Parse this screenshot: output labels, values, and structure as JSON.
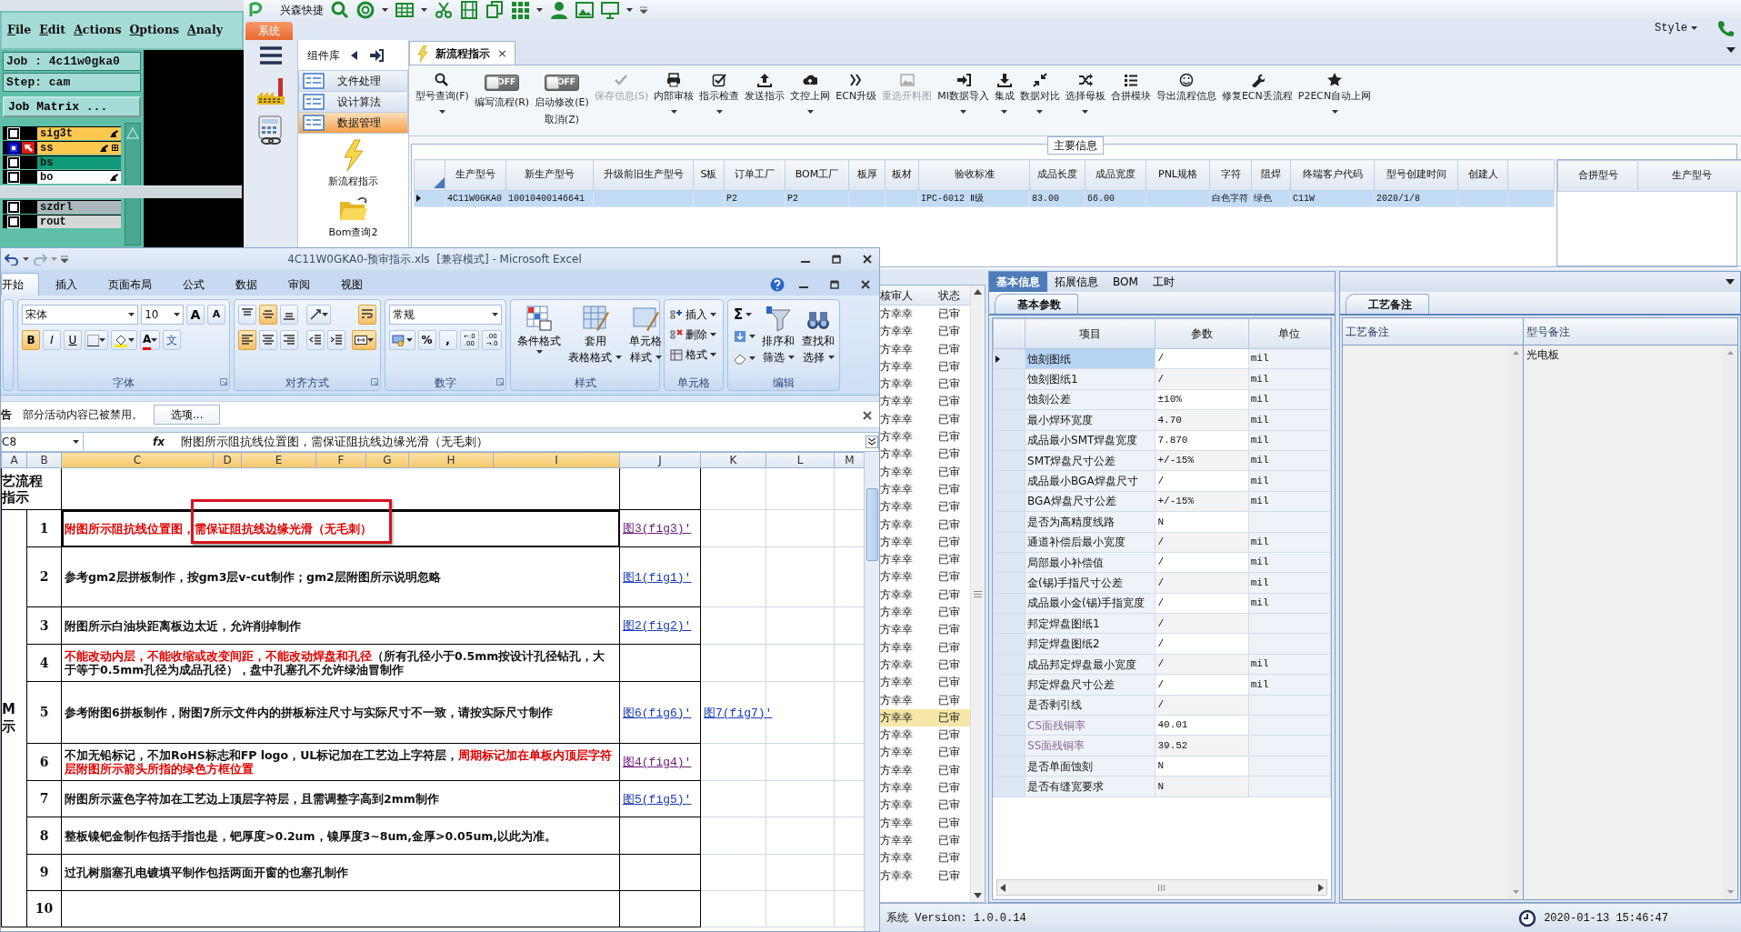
{
  "genesis": {
    "menu": [
      "File",
      "Edit",
      "Actions",
      "Options",
      "Analy"
    ],
    "job": "Job : 4c11w0gka0",
    "step": "Step: cam",
    "matrix_button": "Job Matrix ...",
    "layers": [
      {
        "name": "sig3t",
        "color": "#ffc850",
        "selected": false,
        "affected": true
      },
      {
        "name": "ss",
        "color": "#ffc850",
        "selected": true,
        "affected": true
      },
      {
        "name": "bs",
        "color": "#0f9a78",
        "selected": false,
        "affected": false
      },
      {
        "name": "bo",
        "color": "#ffffff",
        "selected": false,
        "affected": true
      }
    ],
    "lower_layers": [
      {
        "name": "szdrl",
        "color": "#aab8bc",
        "selected": false,
        "affected": false
      },
      {
        "name": "rout",
        "color": "#d4d8d8",
        "selected": false,
        "affected": false
      }
    ]
  },
  "app": {
    "quick_access": "兴森快捷",
    "style": "Style",
    "system_tab": "系统",
    "nav": {
      "title": "组件库",
      "groups": [
        {
          "label": "文件处理",
          "selected": false
        },
        {
          "label": "设计算法",
          "selected": false
        },
        {
          "label": "数据管理",
          "selected": true
        }
      ],
      "items": [
        {
          "label": "新流程指示",
          "kind": "flow"
        },
        {
          "label": "Bom查询2",
          "kind": "folder"
        }
      ]
    },
    "doc_tab": {
      "label": "新流程指示",
      "close": "×"
    },
    "toolbar": [
      {
        "kind": "button",
        "label": "型号查询(F)",
        "dropdown": true,
        "disabled": false
      },
      {
        "kind": "toggle",
        "label": "编写流程(R)",
        "value": "OFF",
        "on": false
      },
      {
        "kind": "toggle",
        "label": "启动修改(E)",
        "label2": "取消(Z)",
        "value": "OFF",
        "on": false
      },
      {
        "kind": "button",
        "label": "保存信息(S)",
        "dropdown": false,
        "disabled": true
      },
      {
        "kind": "button",
        "label": "内部审核",
        "dropdown": true,
        "disabled": false
      },
      {
        "kind": "button",
        "label": "指示检查",
        "dropdown": true,
        "disabled": false
      },
      {
        "kind": "button",
        "label": "发送指示",
        "dropdown": false,
        "disabled": false
      },
      {
        "kind": "button",
        "label": "文控上网",
        "dropdown": true,
        "disabled": false
      },
      {
        "kind": "button",
        "label": "ECN升级",
        "dropdown": false,
        "disabled": false
      },
      {
        "kind": "button",
        "label": "重选开料图",
        "dropdown": false,
        "disabled": true
      },
      {
        "kind": "button",
        "label": "MI数据导入",
        "dropdown": true,
        "disabled": false
      },
      {
        "kind": "button",
        "label": "集成",
        "dropdown": true,
        "disabled": false
      },
      {
        "kind": "button",
        "label": "数据对比",
        "dropdown": true,
        "disabled": false
      },
      {
        "kind": "button",
        "label": "选择母板",
        "dropdown": true,
        "disabled": false
      },
      {
        "kind": "button",
        "label": "合拼模块",
        "dropdown": false,
        "disabled": false
      },
      {
        "kind": "button",
        "label": "导出流程信息",
        "dropdown": false,
        "disabled": false
      },
      {
        "kind": "button",
        "label": "修复ECN丢流程",
        "dropdown": false,
        "disabled": false
      },
      {
        "kind": "button",
        "label": "P2ECN自动上网",
        "dropdown": true,
        "disabled": false
      }
    ],
    "main_info": {
      "title": "主要信息",
      "columns": [
        "生产型号",
        "新生产型号",
        "升级前旧生产型号",
        "S板",
        "订单工厂",
        "BOM工厂",
        "板厚",
        "板材",
        "验收标准",
        "成品长度",
        "成品宽度",
        "PNL规格",
        "字符",
        "阻焊",
        "终端客户代码",
        "型号创建时间",
        "创建人"
      ],
      "rows": [
        {
          "selected": true,
          "cells": [
            "4C11W0GKA0",
            "10010400146641",
            null,
            null,
            "P2",
            "P2",
            null,
            null,
            "IPC-6012 Ⅱ级",
            "83.00",
            "66.00",
            null,
            "白色字符",
            "绿色",
            "C11W",
            "2020/1/8",
            null
          ]
        }
      ],
      "side_columns": [
        "合拼型号",
        "生产型号"
      ]
    },
    "review_list": {
      "columns": [
        "核审人",
        "状态"
      ],
      "rows": [
        {
          "reviewer": "方幸幸",
          "status": "已审",
          "selected": false
        },
        {
          "reviewer": "方幸幸",
          "status": "已审",
          "selected": false
        },
        {
          "reviewer": "方幸幸",
          "status": "已审",
          "selected": false
        },
        {
          "reviewer": "方幸幸",
          "status": "已审",
          "selected": false
        },
        {
          "reviewer": "方幸幸",
          "status": "已审",
          "selected": false
        },
        {
          "reviewer": "方幸幸",
          "status": "已审",
          "selected": false
        },
        {
          "reviewer": "方幸幸",
          "status": "已审",
          "selected": false
        },
        {
          "reviewer": "方幸幸",
          "status": "已审",
          "selected": false
        },
        {
          "reviewer": "方幸幸",
          "status": "已审",
          "selected": false
        },
        {
          "reviewer": "方幸幸",
          "status": "已审",
          "selected": false
        },
        {
          "reviewer": "方幸幸",
          "status": "已审",
          "selected": false
        },
        {
          "reviewer": "方幸幸",
          "status": "已审",
          "selected": false
        },
        {
          "reviewer": "方幸幸",
          "status": "已审",
          "selected": false
        },
        {
          "reviewer": "方幸幸",
          "status": "已审",
          "selected": false
        },
        {
          "reviewer": "方幸幸",
          "status": "已审",
          "selected": false
        },
        {
          "reviewer": "方幸幸",
          "status": "已审",
          "selected": false
        },
        {
          "reviewer": "方幸幸",
          "status": "已审",
          "selected": false
        },
        {
          "reviewer": "方幸幸",
          "status": "已审",
          "selected": false
        },
        {
          "reviewer": "方幸幸",
          "status": "已审",
          "selected": false
        },
        {
          "reviewer": "方幸幸",
          "status": "已审",
          "selected": false
        },
        {
          "reviewer": "方幸幸",
          "status": "已审",
          "selected": false
        },
        {
          "reviewer": "方幸幸",
          "status": "已审",
          "selected": false
        },
        {
          "reviewer": "方幸幸",
          "status": "已审",
          "selected": false
        },
        {
          "reviewer": "方幸幸",
          "status": "已审",
          "selected": true
        },
        {
          "reviewer": "方幸幸",
          "status": "已审",
          "selected": false
        },
        {
          "reviewer": "方幸幸",
          "status": "已审",
          "selected": false
        },
        {
          "reviewer": "方幸幸",
          "status": "已审",
          "selected": false
        },
        {
          "reviewer": "方幸幸",
          "status": "已审",
          "selected": false
        },
        {
          "reviewer": "方幸幸",
          "status": "已审",
          "selected": false
        },
        {
          "reviewer": "方幸幸",
          "status": "已审",
          "selected": false
        },
        {
          "reviewer": "方幸幸",
          "status": "已审",
          "selected": false
        },
        {
          "reviewer": "方幸幸",
          "status": "已审",
          "selected": false
        },
        {
          "reviewer": "方幸幸",
          "status": "已审",
          "selected": false
        }
      ]
    },
    "detail_tabs": [
      {
        "label": "基本信息",
        "selected": true
      },
      {
        "label": "拓展信息",
        "selected": false
      },
      {
        "label": "BOM",
        "selected": false
      },
      {
        "label": "工时",
        "selected": false
      }
    ],
    "params": {
      "tab": "基本参数",
      "columns": [
        "项目",
        "参数",
        "单位"
      ],
      "rows": [
        {
          "item": "蚀刻图纸",
          "value": "/",
          "unit": "mil",
          "selected": true,
          "disabled": false
        },
        {
          "item": "蚀刻图纸1",
          "value": "/",
          "unit": "mil",
          "selected": false,
          "disabled": false
        },
        {
          "item": "蚀刻公差",
          "value": "±10%",
          "unit": "mil",
          "selected": false,
          "disabled": false
        },
        {
          "item": "最小焊环宽度",
          "value": "4.70",
          "unit": "mil",
          "selected": false,
          "disabled": false
        },
        {
          "item": "成品最小SMT焊盘宽度",
          "value": "7.870",
          "unit": "mil",
          "selected": false,
          "disabled": false
        },
        {
          "item": "SMT焊盘尺寸公差",
          "value": "+/-15%",
          "unit": "mil",
          "selected": false,
          "disabled": false
        },
        {
          "item": "成品最小BGA焊盘尺寸",
          "value": "/",
          "unit": "mil",
          "selected": false,
          "disabled": false
        },
        {
          "item": "BGA焊盘尺寸公差",
          "value": "+/-15%",
          "unit": "mil",
          "selected": false,
          "disabled": false
        },
        {
          "item": "是否为高精度线路",
          "value": "N",
          "selected": false,
          "disabled": false
        },
        {
          "item": "通道补偿后最小宽度",
          "value": "/",
          "unit": "mil",
          "selected": false,
          "disabled": false
        },
        {
          "item": "局部最小补偿值",
          "value": "/",
          "unit": "mil",
          "selected": false,
          "disabled": false
        },
        {
          "item": "金(锡)手指尺寸公差",
          "value": "/",
          "unit": "mil",
          "selected": false,
          "disabled": false
        },
        {
          "item": "成品最小金(锡)手指宽度",
          "value": "/",
          "unit": "mil",
          "selected": false,
          "disabled": false
        },
        {
          "item": "邦定焊盘图纸1",
          "value": "/",
          "selected": false,
          "disabled": false
        },
        {
          "item": "邦定焊盘图纸2",
          "value": "/",
          "selected": false,
          "disabled": false
        },
        {
          "item": "成品邦定焊盘最小宽度",
          "value": "/",
          "unit": "mil",
          "selected": false,
          "disabled": false
        },
        {
          "item": "邦定焊盘尺寸公差",
          "value": "/",
          "unit": "mil",
          "selected": false,
          "disabled": false
        },
        {
          "item": "是否剥引线",
          "value": "/",
          "selected": false,
          "disabled": false
        },
        {
          "item": "CS面残铜率",
          "value": "40.01",
          "selected": false,
          "disabled": true
        },
        {
          "item": "SS面残铜率",
          "value": "39.52",
          "selected": false,
          "disabled": true
        },
        {
          "item": "是否单面蚀刻",
          "value": "N",
          "selected": false,
          "disabled": false
        },
        {
          "item": "是否有缝宽要求",
          "value": "N",
          "selected": false,
          "disabled": false
        }
      ]
    },
    "notes": {
      "tab": "工艺备注",
      "columns": [
        {
          "header": "工艺备注"
        },
        {
          "header": "型号备注",
          "text": "光电板"
        }
      ]
    },
    "status": {
      "version": "系统 Version: 1.0.0.14",
      "time": "2020-01-13 15:46:47"
    }
  },
  "excel": {
    "title": "4C11W0GKA0-预审指示.xls  [兼容模式] - Microsoft Excel",
    "tabs": [
      {
        "label": "开始",
        "selected": true
      },
      {
        "label": "插入",
        "selected": false
      },
      {
        "label": "页面布局",
        "selected": false
      },
      {
        "label": "公式",
        "selected": false
      },
      {
        "label": "数据",
        "selected": false
      },
      {
        "label": "审阅",
        "selected": false
      },
      {
        "label": "视图",
        "selected": false
      }
    ],
    "font": "宋体",
    "size": "10",
    "size_buttons": [
      "A",
      "A"
    ],
    "format_buttons": [
      {
        "label": "B",
        "on": true
      },
      {
        "label": "I",
        "on": false
      },
      {
        "label": "U",
        "on": false
      }
    ],
    "font_color_label": "A",
    "phonetic": "文",
    "align_buttons": [
      {
        "selected": false
      },
      {
        "selected": true
      },
      {
        "selected": false
      },
      {
        "selected": false
      },
      {
        "selected": true
      },
      {
        "selected": false
      },
      {
        "selected": false
      },
      {
        "selected": false
      },
      {
        "selected": false
      },
      {
        "selected": true
      },
      {
        "selected": true
      }
    ],
    "number_format": "常规",
    "number_buttons": [
      "%",
      ","
    ],
    "decimals": [
      "←.0 .00",
      ".00 →.0"
    ],
    "style_buttons": [
      {
        "line1": "条件格式"
      },
      {
        "line1": "套用",
        "line2": "表格格式"
      },
      {
        "line1": "单元格",
        "line2": "样式"
      }
    ],
    "cell_buttons": [
      "插入",
      "删除",
      "格式"
    ],
    "sum": "Σ",
    "edit_buttons": [
      {
        "line1": "排序和",
        "line2": "筛选"
      },
      {
        "line1": "查找和",
        "line2": "选择"
      }
    ],
    "groups": [
      "字体",
      "对齐方式",
      "数字",
      "样式",
      "单元格",
      "编辑"
    ],
    "security": {
      "label": "告",
      "message": "部分活动内容已被禁用。",
      "button": "选项..."
    },
    "name_box": "C8",
    "fx": "fx",
    "formula": "附图所示阻抗线位置图，需保证阻抗线边缘光滑（无毛刺）",
    "columns": [
      {
        "label": "A",
        "selected": false
      },
      {
        "label": "B",
        "selected": false
      },
      {
        "label": "C",
        "selected": true
      },
      {
        "label": "D",
        "selected": true
      },
      {
        "label": "E",
        "selected": true
      },
      {
        "label": "F",
        "selected": true
      },
      {
        "label": "G",
        "selected": true
      },
      {
        "label": "H",
        "selected": true
      },
      {
        "label": "I",
        "selected": true
      },
      {
        "label": "J",
        "selected": false
      },
      {
        "label": "K",
        "selected": false
      },
      {
        "label": "L",
        "selected": false
      },
      {
        "label": "M",
        "selected": false
      }
    ],
    "header_text": [
      "艺流程",
      "指示"
    ],
    "side_label": [
      "M",
      "示"
    ],
    "rows": [
      {
        "num": "1",
        "selected": true,
        "annotated": true,
        "parts": [
          {
            "text": "附图所示阻抗线位置图，需保证阻抗线边缘光滑（无毛刺）",
            "red": true
          }
        ],
        "links": [
          {
            "text": "图3(fig3)'",
            "visited": true
          }
        ]
      },
      {
        "num": "2",
        "selected": false,
        "annotated": false,
        "parts": [
          {
            "text": "参考gm2层拼板制作，按gm3层v-cut制作；gm2层附图所示说明忽略",
            "red": false
          }
        ],
        "links": [
          {
            "text": "图1(fig1)'",
            "visited": false
          }
        ]
      },
      {
        "num": "3",
        "selected": false,
        "annotated": false,
        "parts": [
          {
            "text": "附图所示白油块距离板边太近，允许削掉制作",
            "red": false
          }
        ],
        "links": [
          {
            "text": "图2(fig2)'",
            "visited": false
          }
        ]
      },
      {
        "num": "4",
        "selected": false,
        "annotated": false,
        "parts": [
          {
            "text": "不能改动内层，不能收缩或改变间距，不能改动焊盘和孔径",
            "red": true
          },
          {
            "text": "（所有孔径小于0.5mm按设计孔径钻孔，大于等于0.5mm孔径为成品孔径），盘中孔塞孔不允许绿油冒制作",
            "red": false
          }
        ],
        "links": []
      },
      {
        "num": "5",
        "selected": false,
        "annotated": false,
        "parts": [
          {
            "text": "参考附图6拼板制作，附图7所示文件内的拼板标注尺寸与实际尺寸不一致，请按实际尺寸制作",
            "red": false
          }
        ],
        "links": [
          {
            "text": "图6(fig6)'",
            "visited": false
          },
          {
            "text": "图7(fig7)'",
            "visited": false
          }
        ]
      },
      {
        "num": "6",
        "selected": false,
        "annotated": false,
        "parts": [
          {
            "text": "不加无铅标记，不加RoHS标志和FP logo，UL标记加在工艺边上字符层，",
            "red": false
          },
          {
            "text": "周期标记加在单板内顶层字符层附图所示箭头所指的绿色方框位置",
            "red": true
          }
        ],
        "links": [
          {
            "text": "图4(fig4)'",
            "visited": true
          }
        ]
      },
      {
        "num": "7",
        "selected": false,
        "annotated": false,
        "parts": [
          {
            "text": "附图所示蓝色字符加在工艺边上顶层字符层，且需调整字高到2mm制作",
            "red": false
          }
        ],
        "links": [
          {
            "text": "图5(fig5)'",
            "visited": false
          }
        ]
      },
      {
        "num": "8",
        "selected": false,
        "annotated": false,
        "parts": [
          {
            "text": "整板镍钯金制作包括手指也是，钯厚度>0.2um，镍厚度3~8um,金厚>0.05um,以此为准。",
            "red": false
          }
        ],
        "links": []
      },
      {
        "num": "9",
        "selected": false,
        "annotated": false,
        "parts": [
          {
            "text": "过孔树脂塞孔电镀填平制作包括两面开窗的也塞孔制作",
            "red": false
          }
        ],
        "links": []
      },
      {
        "num": "10",
        "selected": false,
        "annotated": false,
        "parts": [],
        "links": []
      }
    ]
  }
}
